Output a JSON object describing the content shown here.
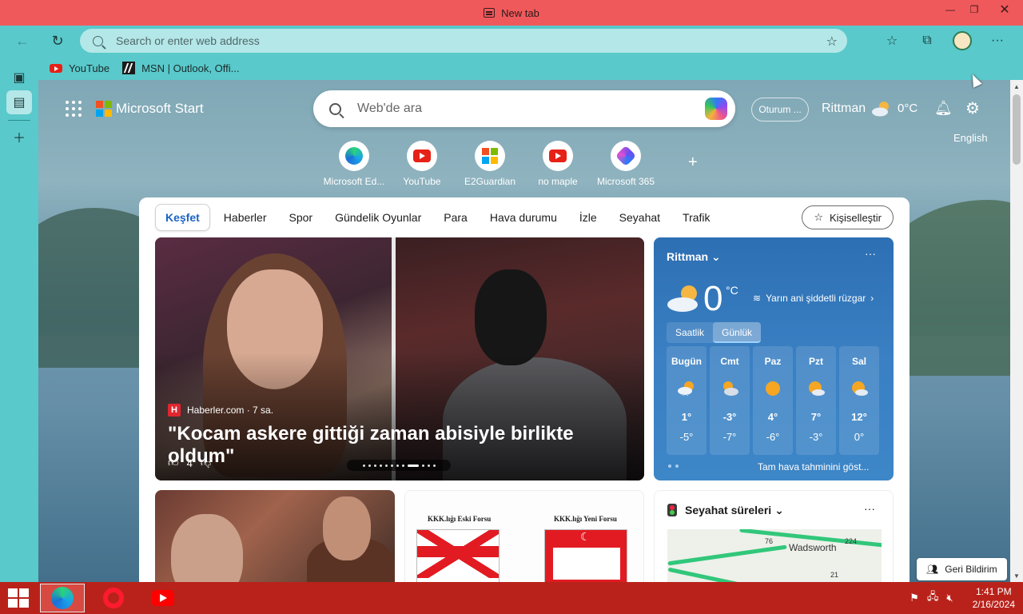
{
  "window": {
    "tab_title": "New tab",
    "controls": {
      "minimize": "—",
      "restore": "❐",
      "close": "✕"
    }
  },
  "toolbar": {
    "address_placeholder": "Search or enter web address",
    "icons": [
      "back-icon",
      "refresh-icon",
      "search-icon",
      "add-favorite-icon",
      "favorites-icon",
      "collections-icon",
      "profile-avatar",
      "more-icon"
    ]
  },
  "favorites": [
    {
      "label": "YouTube",
      "icon": "youtube-icon"
    },
    {
      "label": "MSN | Outlook, Offi...",
      "icon": "msn-icon"
    }
  ],
  "start": {
    "brand": "Microsoft Start",
    "search_placeholder": "Web'de ara",
    "signin": "Oturum ...",
    "location": "Rittman",
    "temp": "0°C",
    "language": "English",
    "quick_links": [
      {
        "label": "Microsoft Ed...",
        "icon": "edge-icon"
      },
      {
        "label": "YouTube",
        "icon": "youtube-icon"
      },
      {
        "label": "E2Guardian",
        "icon": "windows-icon"
      },
      {
        "label": "no maple",
        "icon": "youtube-icon"
      },
      {
        "label": "Microsoft 365",
        "icon": "m365-icon"
      }
    ],
    "add_link": "+"
  },
  "feed": {
    "tabs": [
      "Keşfet",
      "Haberler",
      "Spor",
      "Gündelik Oyunlar",
      "Para",
      "Hava durumu",
      "İzle",
      "Seyahat",
      "Trafik"
    ],
    "active_tab": "Keşfet",
    "personalize": "Kişiselleştir",
    "hero": {
      "source": "Haberler.com · 7 sa.",
      "source_logo": "H",
      "headline": "\"Kocam askere gittiği zaman abisiyle birlikte oldum\"",
      "likes": "4"
    },
    "weather": {
      "location": "Rittman",
      "temp": "0",
      "unit": "°C",
      "alert": "Yarın ani şiddetli rüzgar",
      "toggle": [
        "Saatlik",
        "Günlük"
      ],
      "days": [
        {
          "name": "Bugün",
          "hi": "1°",
          "lo": "-5°",
          "icon": "snow-sun-icon"
        },
        {
          "name": "Cmt",
          "hi": "-3°",
          "lo": "-7°",
          "icon": "partly-cloudy-icon"
        },
        {
          "name": "Paz",
          "hi": "4°",
          "lo": "-6°",
          "icon": "sunny-icon"
        },
        {
          "name": "Pzt",
          "hi": "7°",
          "lo": "-3°",
          "icon": "partly-sunny-icon"
        },
        {
          "name": "Sal",
          "hi": "12°",
          "lo": "0°",
          "icon": "partly-sunny-icon"
        }
      ],
      "full_forecast": "Tam hava tahminini göst..."
    },
    "flags_card": {
      "left_label": "KKK.lığı Eski Forsu",
      "right_label": "KKK.lığı Yeni Forsu"
    },
    "travel": {
      "title": "Seyahat süreleri",
      "map_city": "Wadsworth",
      "route_labels": [
        "76",
        "224",
        "21"
      ]
    },
    "feedback": "Geri Bildirim"
  },
  "taskbar": {
    "apps": [
      "edge-icon",
      "opera-icon",
      "youtube-icon"
    ],
    "time": "1:41 PM",
    "date": "2/16/2024"
  }
}
